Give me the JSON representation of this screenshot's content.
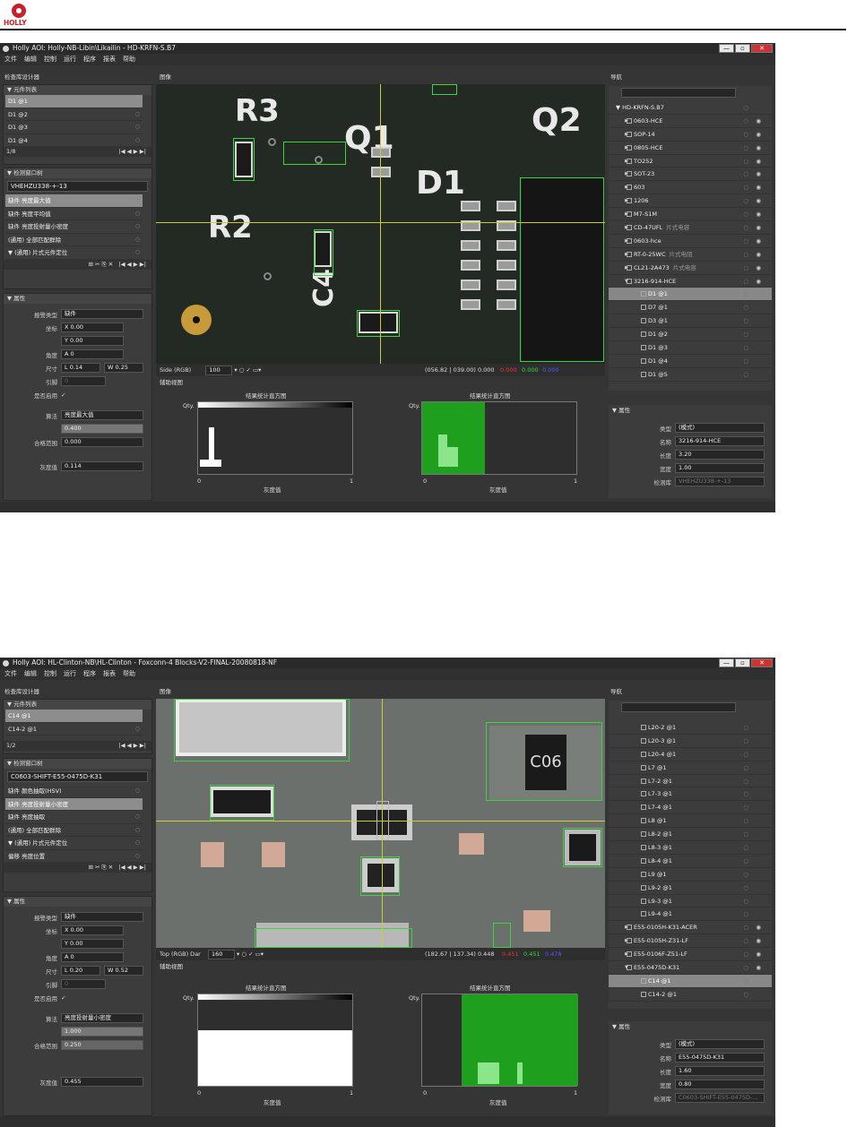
{
  "doc": {
    "logo_text": "HOLLY"
  },
  "colors": {
    "accent_green": "#2ea52e",
    "panel_bg": "#3c3c3c",
    "brand_red": "#c8202a"
  },
  "menu": [
    "文件",
    "编辑",
    "控制",
    "运行",
    "程序",
    "报表",
    "帮助"
  ],
  "win1": {
    "title": "Holly AOI: Holly-NB-Libin\\Likailin - HD-KRFN-S.B7",
    "panel_label": "检查库设计器",
    "image_label": "图像",
    "nav_label": "导航",
    "component_list": {
      "title": "▼ 元件列表",
      "items": [
        "D1 @1",
        "D1 @2",
        "D1 @3",
        "D1 @4"
      ],
      "footer": "1/8"
    },
    "window_tree": {
      "title": "▼ 检测窗口树",
      "name": "VHEHZU338-+-13",
      "items": [
        "缺件 亮度最大值",
        "缺件 亮度平均值",
        "缺件 亮度投射量小密度",
        "(通用) 全部匹配群除",
        "▼ (通用) 片式元件定位",
        "(通用) ..."
      ]
    },
    "props": {
      "title": "▼ 属性",
      "type_label": "报警类型",
      "type_val": "缺件",
      "coord_label": "坐标",
      "x": "0.00",
      "y": "0.00",
      "angle_label": "角度",
      "angle": "0",
      "size_label": "尺寸",
      "l": "0.14",
      "w": "0.25",
      "pin_label": "引脚",
      "pin": "0",
      "enable_label": "是否启用",
      "algo_label": "算法",
      "algo": "亮度最大值",
      "range_label": "合格范围",
      "range_hi": "0.400",
      "range_lo": "0.000",
      "gray_label": "灰度值",
      "gray": "0.114"
    },
    "image_toolbar": {
      "mode": "Side (RGB)",
      "zoom": "100",
      "readout": "(056.82 | 039.00) 0.000",
      "r": "0.000",
      "g": "0.000",
      "b": "0.000"
    },
    "aux_label": "辅助视图",
    "hist1": {
      "title": "结果统计直方图",
      "ylabel": "Qty.",
      "xlabel": "灰度值",
      "x0": "0",
      "x1": "1"
    },
    "hist2": {
      "title": "结果统计直方图",
      "ylabel": "Qty.",
      "xlabel": "灰度值",
      "x0": "0",
      "x1": "1"
    },
    "nav_tree": [
      {
        "label": "HD-KRFN-S.B7",
        "lvl": 0
      },
      {
        "label": "0603-HCE",
        "lvl": 1
      },
      {
        "label": "SOP-14",
        "lvl": 1
      },
      {
        "label": "0805-HCE",
        "lvl": 1
      },
      {
        "label": "TO252",
        "lvl": 1
      },
      {
        "label": "SOT-23",
        "lvl": 1
      },
      {
        "label": "603",
        "lvl": 1
      },
      {
        "label": "1206",
        "lvl": 1
      },
      {
        "label": "M7-S1M",
        "lvl": 1
      },
      {
        "label": "CD-47UFL",
        "tag": "片式电容",
        "lvl": 1
      },
      {
        "label": "0603-hce",
        "lvl": 1
      },
      {
        "label": "RT-0-25WC",
        "tag": "片式电阻",
        "lvl": 1
      },
      {
        "label": "CL21-2A473",
        "tag": "片式电容",
        "lvl": 1
      },
      {
        "label": "3216-914-HCE",
        "lvl": 1,
        "open": true
      },
      {
        "label": "D1 @1",
        "lvl": 2,
        "sel": true
      },
      {
        "label": "D7 @1",
        "lvl": 2
      },
      {
        "label": "D3 @1",
        "lvl": 2
      },
      {
        "label": "D1 @2",
        "lvl": 2
      },
      {
        "label": "D1 @3",
        "lvl": 2
      },
      {
        "label": "D1 @4",
        "lvl": 2
      },
      {
        "label": "D1 @5",
        "lvl": 2
      }
    ],
    "rprops": {
      "title": "▼ 属性",
      "type_label": "类型",
      "type": "(模式)",
      "name_label": "名称",
      "name": "3216-914-HCE",
      "len_label": "长度",
      "len": "3.20",
      "wid_label": "宽度",
      "wid": "1.00",
      "lib_label": "检测库",
      "lib": "VHEHZU338-+-13"
    }
  },
  "win2": {
    "title": "Holly AOI: HL-Clinton-NB\\HL-Clinton - Foxconn-4 Blocks-V2-FINAL-20080818-NF",
    "panel_label": "检查库设计器",
    "image_label": "图像",
    "nav_label": "导航",
    "component_list": {
      "title": "▼ 元件列表",
      "items": [
        "C14 @1",
        "C14-2 @1"
      ],
      "footer": "1/2"
    },
    "window_tree": {
      "title": "▼ 检测窗口树",
      "name": "C0603-SHIFT-E55-0475D-K31",
      "items": [
        "缺件 颜色抽取(HSV)",
        "缺件 亮度投射量小密度",
        "缺件 亮度抽取",
        "(通用) 全部匹配群除",
        "▼ (通用) 片式元件定位",
        "偏移 亮度位置"
      ]
    },
    "props": {
      "title": "▼ 属性",
      "type_label": "报警类型",
      "type_val": "缺件",
      "coord_label": "坐标",
      "x": "0.00",
      "y": "0.00",
      "angle_label": "角度",
      "angle": "0",
      "size_label": "尺寸",
      "l": "0.20",
      "w": "0.52",
      "pin_label": "引脚",
      "pin": "0",
      "enable_label": "是否启用",
      "algo_label": "算法",
      "algo": "亮度投射量小密度",
      "range_label": "合格范围",
      "range_hi": "1.000",
      "range_lo": "0.250",
      "gray_label": "灰度值",
      "gray": "0.455"
    },
    "image_toolbar": {
      "mode": "Top (RGB) Dar",
      "zoom": "160",
      "readout": "(182.67 | 137.34) 0.448",
      "r": "0.451",
      "g": "0.451",
      "b": "0.478"
    },
    "aux_label": "辅助视图",
    "hist1": {
      "title": "结果统计直方图",
      "ylabel": "Qty.",
      "xlabel": "灰度值",
      "x0": "0",
      "x1": "1"
    },
    "hist2": {
      "title": "结果统计直方图",
      "ylabel": "Qty.",
      "xlabel": "灰度值",
      "x0": "0",
      "x1": "1"
    },
    "nav_tree": [
      {
        "label": "L20-2 @1",
        "lvl": 2
      },
      {
        "label": "L20-3 @1",
        "lvl": 2
      },
      {
        "label": "L20-4 @1",
        "lvl": 2
      },
      {
        "label": "L7 @1",
        "lvl": 2
      },
      {
        "label": "L7-2 @1",
        "lvl": 2
      },
      {
        "label": "L7-3 @1",
        "lvl": 2
      },
      {
        "label": "L7-4 @1",
        "lvl": 2
      },
      {
        "label": "L8 @1",
        "lvl": 2
      },
      {
        "label": "L8-2 @1",
        "lvl": 2
      },
      {
        "label": "L8-3 @1",
        "lvl": 2
      },
      {
        "label": "L8-4 @1",
        "lvl": 2
      },
      {
        "label": "L9 @1",
        "lvl": 2
      },
      {
        "label": "L9-2 @1",
        "lvl": 2
      },
      {
        "label": "L9-3 @1",
        "lvl": 2
      },
      {
        "label": "L9-4 @1",
        "lvl": 2
      },
      {
        "label": "E55-0105H-K31-ACER",
        "lvl": 1
      },
      {
        "label": "E55-0105H-Z31-LF",
        "lvl": 1
      },
      {
        "label": "E55-0106F-Z51-LF",
        "lvl": 1
      },
      {
        "label": "E55-0475D-K31",
        "lvl": 1,
        "open": true
      },
      {
        "label": "C14 @1",
        "lvl": 2,
        "sel": true
      },
      {
        "label": "C14-2 @1",
        "lvl": 2
      }
    ],
    "rprops": {
      "title": "▼ 属性",
      "type_label": "类型",
      "type": "(模式)",
      "name_label": "名称",
      "name": "E55-0475D-K31",
      "len_label": "长度",
      "len": "1.60",
      "wid_label": "宽度",
      "wid": "0.80",
      "lib_label": "检测库",
      "lib": "C0603-SHIFT-E55-0475D-..."
    }
  }
}
